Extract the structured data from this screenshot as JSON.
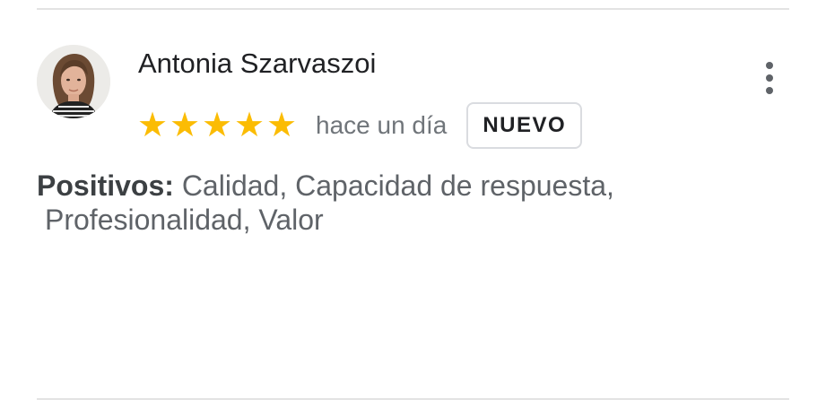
{
  "review": {
    "reviewer_name": "Antonia Szarvaszoi",
    "rating": 5,
    "stars": [
      "★",
      "★",
      "★",
      "★",
      "★"
    ],
    "timestamp": "hace un día",
    "badge": "NUEVO",
    "highlights_label": "Positivos:",
    "highlights_line1": "Calidad, Capacidad de respuesta,",
    "highlights_line2": "Profesionalidad, Valor"
  },
  "icons": {
    "avatar": "reviewer-photo",
    "more": "more-vert-icon",
    "star": "star-icon"
  },
  "colors": {
    "star": "#fbbc04",
    "name": "#202124",
    "secondary_text": "#5f6368",
    "timestamp": "#70757a",
    "divider": "#e3e3e3",
    "badge_border": "#dadce0"
  }
}
